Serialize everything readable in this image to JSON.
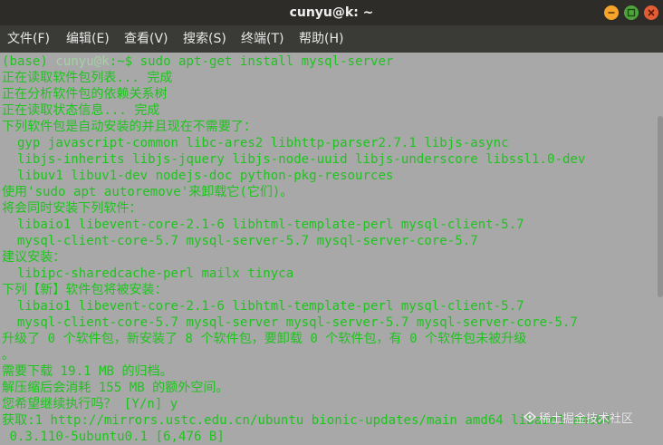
{
  "window": {
    "title": "cunyu@k: ~"
  },
  "menu": {
    "items": [
      "文件(F)",
      "编辑(E)",
      "查看(V)",
      "搜索(S)",
      "终端(T)",
      "帮助(H)"
    ]
  },
  "terminal": {
    "prompt_env": "(base) ",
    "prompt_user": "cunyu@k",
    "prompt_rest": ":~$ sudo apt-get install mysql-server",
    "lines": [
      "正在读取软件包列表... 完成",
      "正在分析软件包的依赖关系树",
      "正在读取状态信息... 完成",
      "下列软件包是自动安装的并且现在不需要了：",
      "  gyp javascript-common libc-ares2 libhttp-parser2.7.1 libjs-async",
      "  libjs-inherits libjs-jquery libjs-node-uuid libjs-underscore libssl1.0-dev",
      "  libuv1 libuv1-dev nodejs-doc python-pkg-resources",
      "使用'sudo apt autoremove'来卸载它(它们)。",
      "将会同时安装下列软件：",
      "  libaio1 libevent-core-2.1-6 libhtml-template-perl mysql-client-5.7",
      "  mysql-client-core-5.7 mysql-server-5.7 mysql-server-core-5.7",
      "建议安装：",
      "  libipc-sharedcache-perl mailx tinyca",
      "下列【新】软件包将被安装：",
      "  libaio1 libevent-core-2.1-6 libhtml-template-perl mysql-client-5.7",
      "  mysql-client-core-5.7 mysql-server mysql-server-5.7 mysql-server-core-5.7",
      "升级了 0 个软件包，新安装了 8 个软件包，要卸载 0 个软件包，有 0 个软件包未被升级",
      "。",
      "需要下载 19.1 MB 的归档。",
      "解压缩后会消耗 155 MB 的额外空间。",
      "您希望继续执行吗？ [Y/n] y",
      "获取:1 http://mirrors.ustc.edu.cn/ubuntu bionic-updates/main amd64 libaio1 amd64",
      " 0.3.110-5ubuntu0.1 [6,476 B]"
    ]
  },
  "watermark": {
    "text": "稀土掘金技术社区"
  },
  "colors": {
    "terminal_bg": "#a8a8a8",
    "terminal_text": "#1fc31f",
    "titlebar_bg": "#2d2c29",
    "menubar_bg": "#3a3a36"
  }
}
